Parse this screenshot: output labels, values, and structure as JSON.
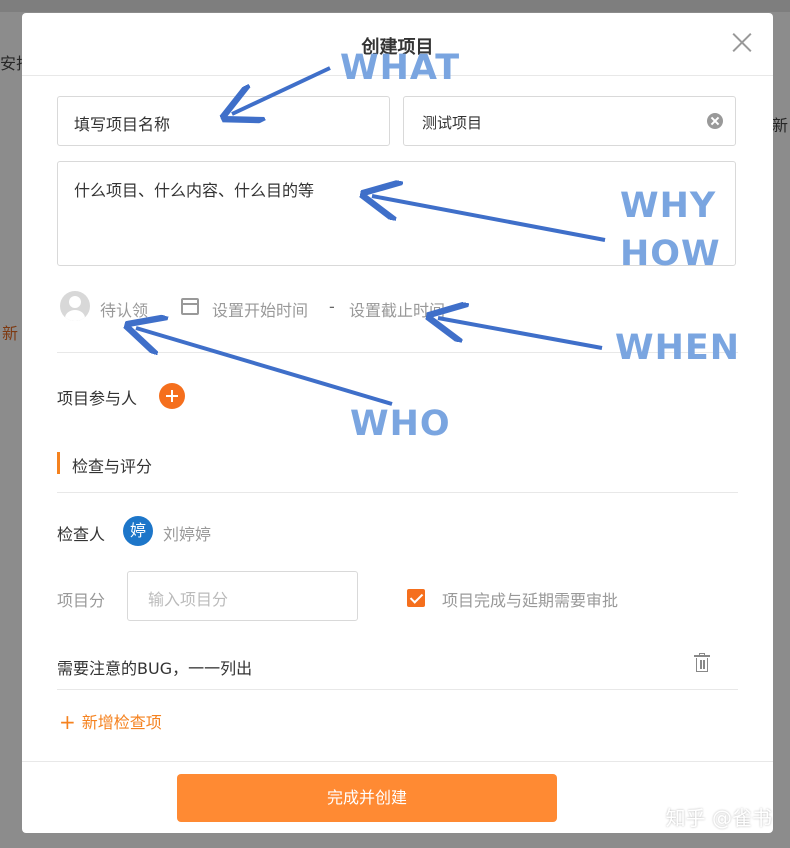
{
  "background": {
    "left_text": "安排",
    "new_text": "新",
    "right_text": "新"
  },
  "modal": {
    "title": "创建项目",
    "name_input_value": "填写项目名称",
    "category_value": "测试项目",
    "description_value": "什么项目、什么内容、什么目的等",
    "assignee_placeholder": "待认领",
    "start_time_placeholder": "设置开始时间",
    "time_separator": "-",
    "end_time_placeholder": "设置截止时间",
    "participants_label": "项目参与人",
    "section_title": "检查与评分",
    "checker_label": "检查人",
    "checker_avatar_char": "婷",
    "checker_name": "刘婷婷",
    "score_label": "项目分",
    "score_placeholder": "输入项目分",
    "approval_checkbox_label": "项目完成与延期需要审批",
    "approval_checked": true,
    "check_items": [
      "需要注意的BUG，一一列出"
    ],
    "add_check_label": "新增检查项",
    "submit_label": "完成并创建"
  },
  "annotations": {
    "what": "WHAT",
    "why": "WHY",
    "how": "HOW",
    "when": "WHEN",
    "who": "WHO",
    "color": "#3f6fc9"
  },
  "watermark": "知乎 @雀书",
  "colors": {
    "accent": "#ff8a33",
    "checker_avatar": "#1d76c9"
  }
}
